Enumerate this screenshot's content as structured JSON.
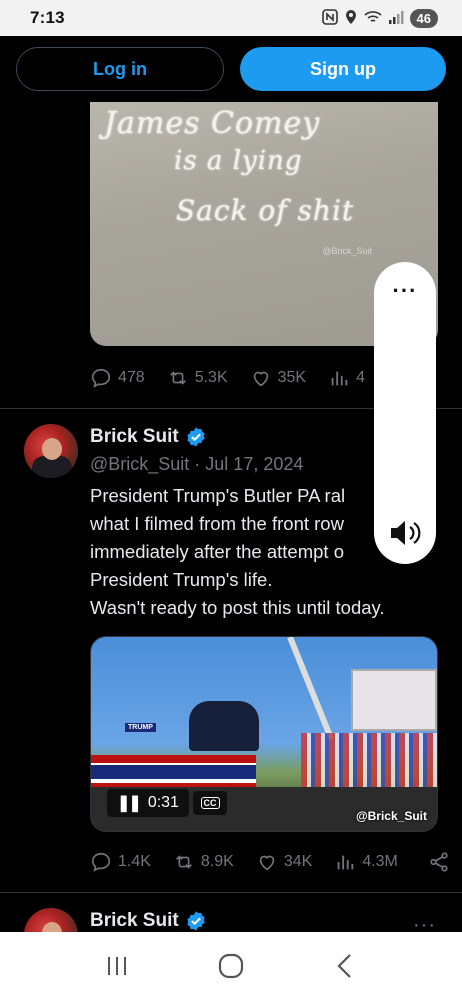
{
  "status": {
    "time": "7:13",
    "icons": [
      "nfc-icon",
      "location-icon",
      "wifi-icon",
      "signal-icon"
    ],
    "battery": "46"
  },
  "auth": {
    "login_label": "Log in",
    "signup_label": "Sign up"
  },
  "tweet1": {
    "image_text": [
      "James Comey",
      "is a lying",
      "Sack of shit"
    ],
    "image_watermark": "@Brick_Suit",
    "stats": {
      "replies": "478",
      "reposts": "5.3K",
      "likes": "35K",
      "views": "4"
    }
  },
  "tweet2": {
    "name": "Brick Suit",
    "handle_date": "@Brick_Suit · Jul 17, 2024",
    "text_lines": [
      "President Trump's Butler PA ral",
      "what I filmed from the front row",
      "immediately after the attempt o",
      "President Trump's life.",
      "Wasn't ready to post this until today."
    ],
    "video": {
      "time": "0:31",
      "cc_label": "CC",
      "watermark": "@Brick_Suit",
      "stage_sign": "TRUMP"
    },
    "stats": {
      "replies": "1.4K",
      "reposts": "8.9K",
      "likes": "34K",
      "views": "4.3M"
    }
  },
  "tweet3": {
    "name": "Brick Suit",
    "more": "···"
  },
  "overlay": {
    "more": "···"
  },
  "colors": {
    "accent": "#1d9bf0",
    "background": "#000000",
    "muted": "#71767b"
  }
}
